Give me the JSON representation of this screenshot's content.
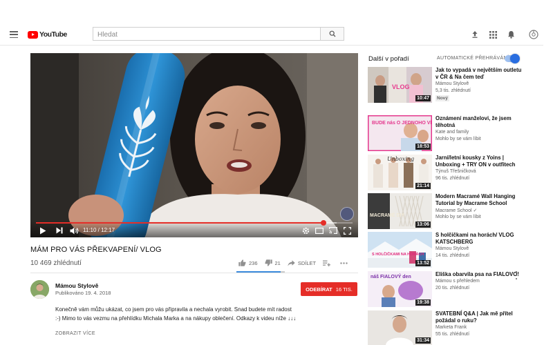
{
  "header": {
    "logo_text": "YouTube",
    "search_placeholder": "Hledat"
  },
  "player": {
    "time_current": "11:10",
    "time_total": "12:17",
    "progress_fraction": 0.908,
    "loaded_fraction": 0.95
  },
  "video": {
    "title": "MÁM PRO VÁS PŘEKVAPENÍ/ VLOG",
    "views": "10 469 zhlédnutí",
    "likes": "236",
    "dislikes": "21",
    "share_label": "SDÍLET",
    "like_ratio": 0.918
  },
  "channel": {
    "name": "Mámou Stylově",
    "published": "Publikováno 19. 4. 2018",
    "subscribe_label": "ODEBÍRAT",
    "subscriber_count": "16 TIS.",
    "description_line1": "Konečně vám můžu ukázat,  co jsem pro vás připravila a nechala vyrobit. Snad budete mít radost",
    "description_line2": ":-) Mimo to vás vezmu na přehlídku Michala Marka a na nákupy oblečení. Odkazy k videu níže ↓↓↓",
    "show_more_label": "ZOBRAZIT VÍCE"
  },
  "sidebar": {
    "up_next_label": "Další v pořadí",
    "autoplay_label": "AUTOMATICKÉ PŘEHRÁVÁNÍ",
    "autoplay_on": true,
    "items": [
      {
        "title": "Jak to vypadá v největším outletu v ČR & Na čem teď",
        "channel": "Mámou Stylově",
        "meta": "5,3 tis. zhlédnutí",
        "badge": "Nový",
        "duration": "10:47",
        "thumb_text": "VLOG"
      },
      {
        "title": "Oznámení manželovi, že jsem těhotná",
        "channel": "Kate and family",
        "meta": "Mohlo by se vám líbit",
        "duration": "18:53",
        "thumb_text": "BUDE nás O JEDNOHO VÍC"
      },
      {
        "title": "Jarní/letní kousky z Yoins | Unboxing + TRY ON v outfitech",
        "channel": "Týnuš Třešničková",
        "meta": "96 tis. zhlédnutí",
        "duration": "21:14",
        "thumb_text": "Unboxing"
      },
      {
        "title": "Modern Macramé Wall Hanging Tutorial by Macrame School",
        "channel": "Macrame School ✓",
        "meta": "Mohlo by se vám líbit",
        "duration": "13:06",
        "thumb_text": "MACRAMÉ DIY"
      },
      {
        "title": "S holčičkami na horách/ VLOG KATSCHBERG",
        "channel": "Mámou Stylově",
        "meta": "14 tis. zhlédnutí",
        "duration": "13:52",
        "thumb_text": "S HOLČIČKAMI NA HORÁCH"
      },
      {
        "title": "Eliška obarvila psa na FIALOVO!",
        "channel": "Mámou s přehledem",
        "meta": "20 tis. zhlédnutí",
        "duration": "19:38",
        "thumb_text": "náš FIALOVÝ den"
      },
      {
        "title": "SVATEBNÍ Q&A | Jak mě přítel požádal o ruku?",
        "channel": "Marketa Frank",
        "meta": "55 tis. zhlédnutí",
        "duration": "31:34",
        "thumb_text": ""
      }
    ]
  },
  "colors": {
    "brand_red": "#ff0000",
    "subscribe_red": "#e52d27",
    "progress_red": "#e52d27",
    "autoplay_blue": "#2a6ee0",
    "bottle_blue": "#1f7fc4"
  }
}
